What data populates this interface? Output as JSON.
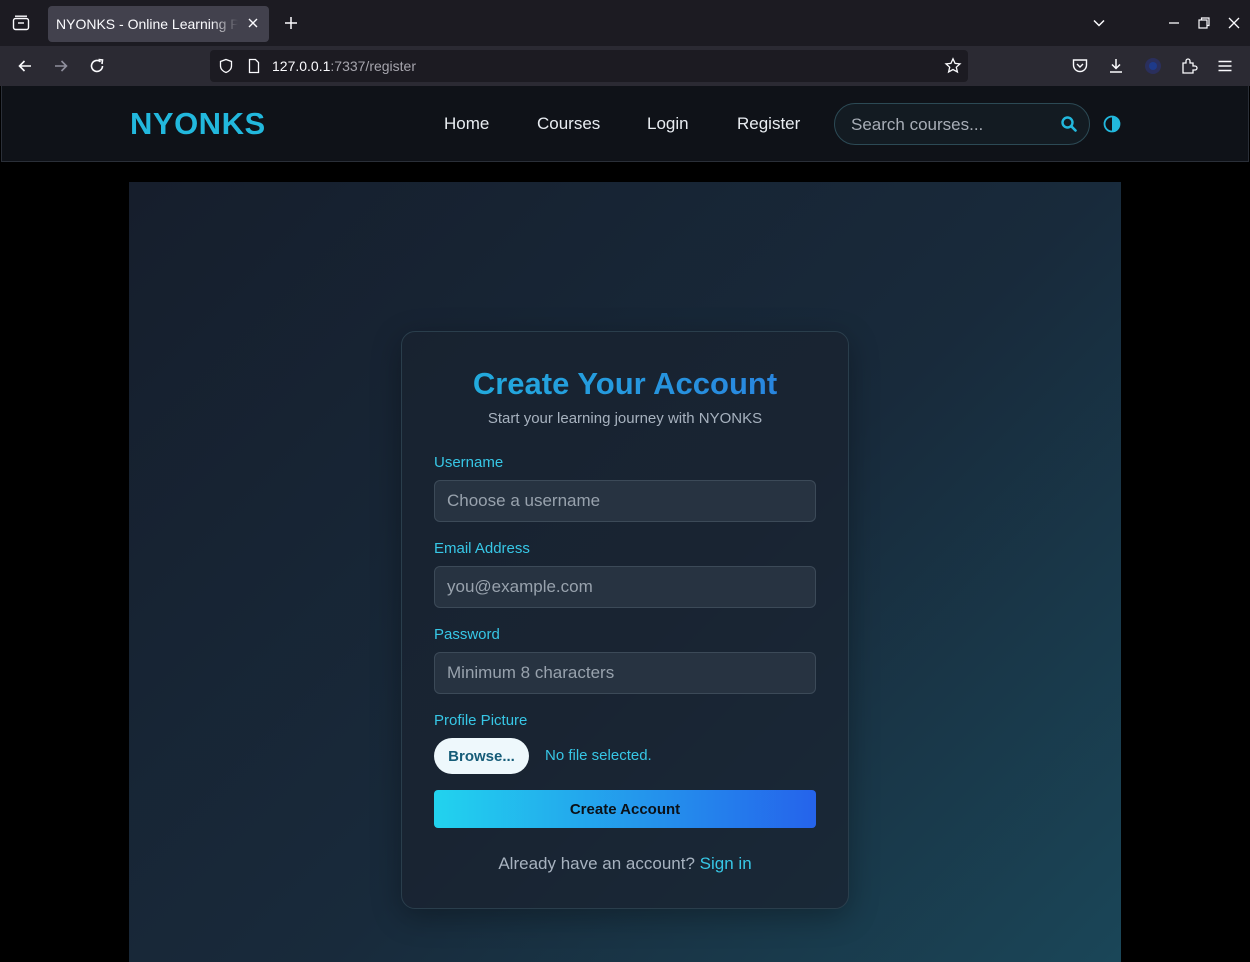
{
  "browser": {
    "tab_title": "NYONKS - Online Learning Platform",
    "url_host": "127.0.0.1",
    "url_path": ":7337/register"
  },
  "site": {
    "logo": "NYONKS",
    "nav": [
      "Home",
      "Courses",
      "Login",
      "Register"
    ],
    "search_placeholder": "Search courses...",
    "accent_color": "#22b8dd"
  },
  "form": {
    "title": "Create Your Account",
    "subtitle": "Start your learning journey with NYONKS",
    "username_label": "Username",
    "username_placeholder": "Choose a username",
    "email_label": "Email Address",
    "email_placeholder": "you@example.com",
    "password_label": "Password",
    "password_placeholder": "Minimum 8 characters",
    "picture_label": "Profile Picture",
    "browse_label": "Browse...",
    "file_status": "No file selected.",
    "submit_label": "Create Account",
    "signin_prompt": "Already have an account?",
    "signin_link": "Sign in"
  }
}
